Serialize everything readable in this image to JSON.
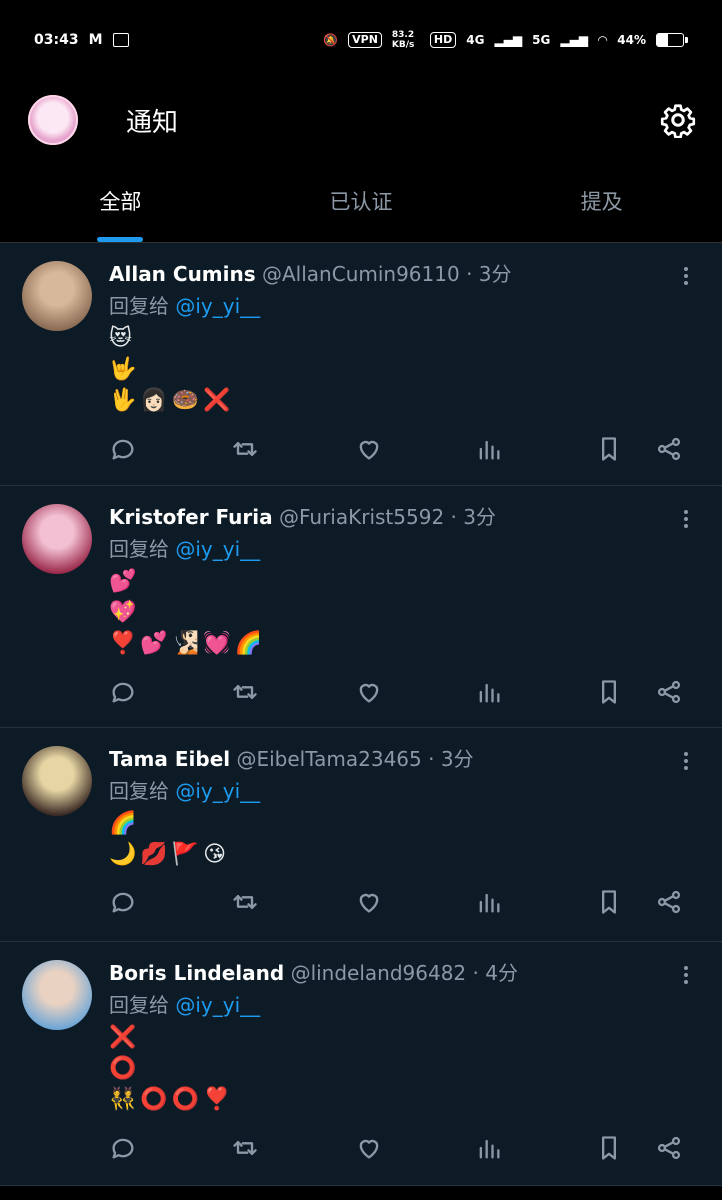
{
  "status_bar": {
    "time": "03:43",
    "vpn": "VPN",
    "net_speed": "83.2 KB/s",
    "hd": "HD",
    "net1": "4G",
    "net2": "5G",
    "battery_text": "44%",
    "battery_level": 0.44
  },
  "header": {
    "title": "通知"
  },
  "tabs": [
    {
      "label": "全部",
      "active": true
    },
    {
      "label": "已认证",
      "active": false
    },
    {
      "label": "提及",
      "active": false
    }
  ],
  "notifications": [
    {
      "name": "Allan Cumins",
      "handle": "@AllanCumin96110",
      "time": "· 3分",
      "reply_prefix": "回复给",
      "mention": "@iy_yi__",
      "lines": [
        "😻",
        "🤟",
        "🖖👩🏻🍩❌"
      ],
      "avatar_colors": [
        "#8a6c55",
        "#d8b89a"
      ]
    },
    {
      "name": "Kristofer Furia",
      "handle": "@FuriaKrist5592",
      "time": "· 3分",
      "reply_prefix": "回复给",
      "mention": "@iy_yi__",
      "lines": [
        "💕",
        "💖",
        "❣️💕🧏🏻💓🌈"
      ],
      "avatar_colors": [
        "#9b2a4b",
        "#f3c0d3"
      ]
    },
    {
      "name": "Tama Eibel",
      "handle": "@EibelTama23465",
      "time": "· 3分",
      "reply_prefix": "回复给",
      "mention": "@iy_yi__",
      "lines": [
        "🌈",
        "🌙💋🚩😘"
      ],
      "avatar_colors": [
        "#3b2a24",
        "#e7d6a4"
      ]
    },
    {
      "name": "Boris Lindeland",
      "handle": "@lindeland96482",
      "time": "· 4分",
      "reply_prefix": "回复给",
      "mention": "@iy_yi__",
      "lines": [
        "❌",
        "⭕",
        "👯⭕⭕❣️"
      ],
      "avatar_colors": [
        "#6ea6d6",
        "#e9d2c2"
      ]
    }
  ],
  "colors": {
    "background": "#0c1b26",
    "accent": "#1d9bf0",
    "muted": "#8b98a5"
  }
}
